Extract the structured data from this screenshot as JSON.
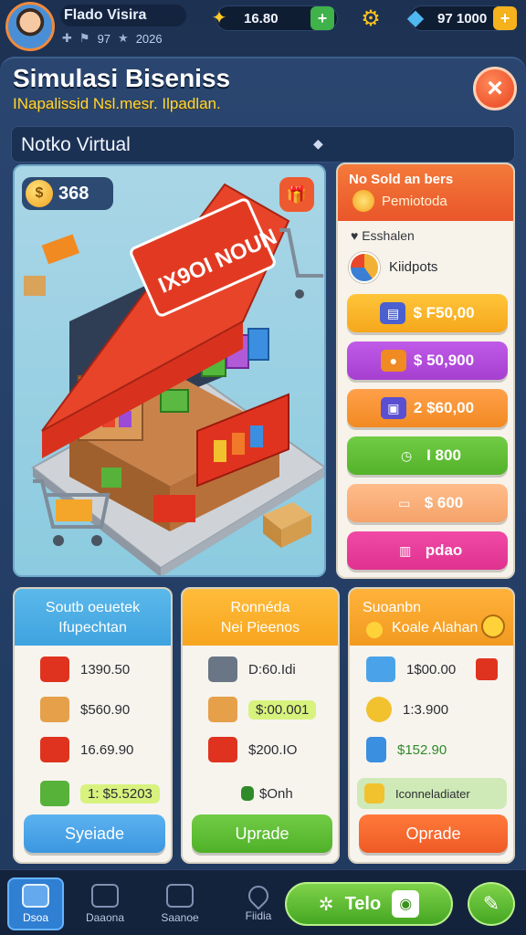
{
  "player": {
    "name": "Flado Visira",
    "level": "97",
    "rank": "2026"
  },
  "currencies": {
    "gold": "16.80",
    "gems": "97 1000"
  },
  "header": {
    "title": "Simulasi Biseniss",
    "subtitle": "INapalissid Nsl.mesr. Ilpadlan.",
    "close_icon": "×"
  },
  "store_selector": {
    "label": "Notko Virtual"
  },
  "scene": {
    "coins": "368",
    "sign_text": "IX9OI NOUN"
  },
  "offers": {
    "heading": "No Sold an bers",
    "subheading": "Pemiotoda",
    "section_label": "Esshalen",
    "kpi_label": "Kiidpots",
    "items": [
      {
        "label": "$ F50,00",
        "color": "#f6a71c"
      },
      {
        "label": "$ 50,900",
        "color": "#a63fd0"
      },
      {
        "label": "2 $60,00",
        "color": "#f28a22"
      },
      {
        "label": "I 800",
        "color": "#53b22a"
      },
      {
        "label": "$ 600",
        "color": "#f5a36a"
      },
      {
        "label": "pdao",
        "color": "#e0318f"
      }
    ]
  },
  "cards": [
    {
      "heading1": "Soutb oeuetek",
      "heading2": "Ifupechtan",
      "head_color": "#3fa3df",
      "rows": [
        "1390.50",
        "$560.90",
        "16.69.90",
        "1: $5.5203"
      ],
      "button": "Syeiade",
      "button_color": "#3c97e0"
    },
    {
      "heading1": "Ronnéda",
      "heading2": "Nei Pieenos",
      "head_color": "#f7a51f",
      "rows": [
        "D:60.Idi",
        "$:00.001",
        "$200.IO",
        "$Onh"
      ],
      "button": "Uprade",
      "button_color": "#4fb128"
    },
    {
      "heading1": "Suoanbn",
      "heading2": "Koale Alahan",
      "head_color": "#f29a20",
      "rows": [
        "1$00.00",
        "1:3.900",
        "$152.90",
        "Iconneladiater"
      ],
      "button": "Oprade",
      "button_color": "#ef5a25"
    }
  ],
  "nav": {
    "items": [
      "Dsoa",
      "Daaona",
      "Saanoe",
      "Fiidia"
    ],
    "tele_label": "Telo"
  }
}
